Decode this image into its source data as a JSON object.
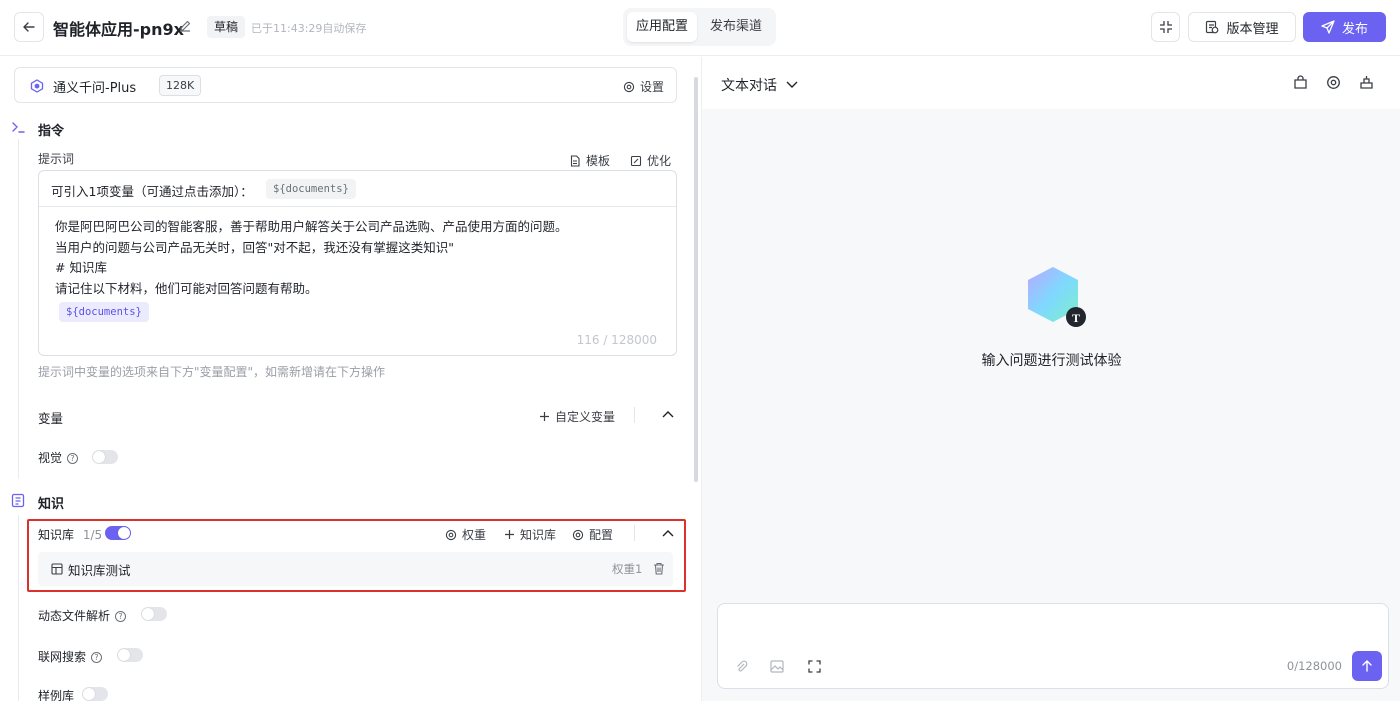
{
  "header": {
    "app_title": "智能体应用-pn9x",
    "draft_label": "草稿",
    "saved_text": "已于11:43:29自动保存",
    "tabs": [
      {
        "label": "应用配置",
        "active": true
      },
      {
        "label": "发布渠道",
        "active": false
      }
    ],
    "version_label": "版本管理",
    "publish_label": "发布",
    "accent_color": "#6b62f2"
  },
  "left": {
    "model": {
      "name": "通义千问-Plus",
      "context": "128K",
      "settings_label": "设置"
    },
    "instruction": {
      "section_title": "指令",
      "prompt_label": "提示词",
      "template_label": "模板",
      "optimize_label": "优化",
      "variable_bar_text": "可引入1项变量（可通过点击添加）：",
      "variable_chip": "${documents}",
      "prompt_lines": [
        "你是阿巴阿巴公司的智能客服，善于帮助用户解答关于公司产品选购、产品使用方面的问题。",
        "当用户的问题与公司产品无关时，回答\"对不起，我还没有掌握这类知识\"",
        "# 知识库",
        "请记住以下材料，他们可能对回答问题有帮助。"
      ],
      "prompt_variable": "${documents}",
      "char_count": "116 / 128000",
      "hint": "提示词中变量的选项来自下方\"变量配置\"，如需新增请在下方操作"
    },
    "variables": {
      "label": "变量",
      "add_label": "自定义变量"
    },
    "vision": {
      "label": "视觉",
      "enabled": false
    },
    "knowledge": {
      "section_title": "知识",
      "kb_label": "知识库",
      "kb_count": "1/5",
      "kb_enabled": true,
      "weight_label": "权重",
      "add_kb_label": "知识库",
      "config_label": "配置",
      "items": [
        {
          "name": "知识库测试",
          "weight": "权重1"
        }
      ],
      "highlight_color": "#d9322b"
    },
    "dynamic_file": {
      "label": "动态文件解析",
      "enabled": false
    },
    "web_search": {
      "label": "联网搜索",
      "enabled": false
    },
    "examples": {
      "label": "样例库",
      "enabled": false
    }
  },
  "right": {
    "mode_label": "文本对话",
    "empty_text": "输入问题进行测试体验",
    "avatar_letter": "T",
    "composer_count": "0/128000"
  }
}
